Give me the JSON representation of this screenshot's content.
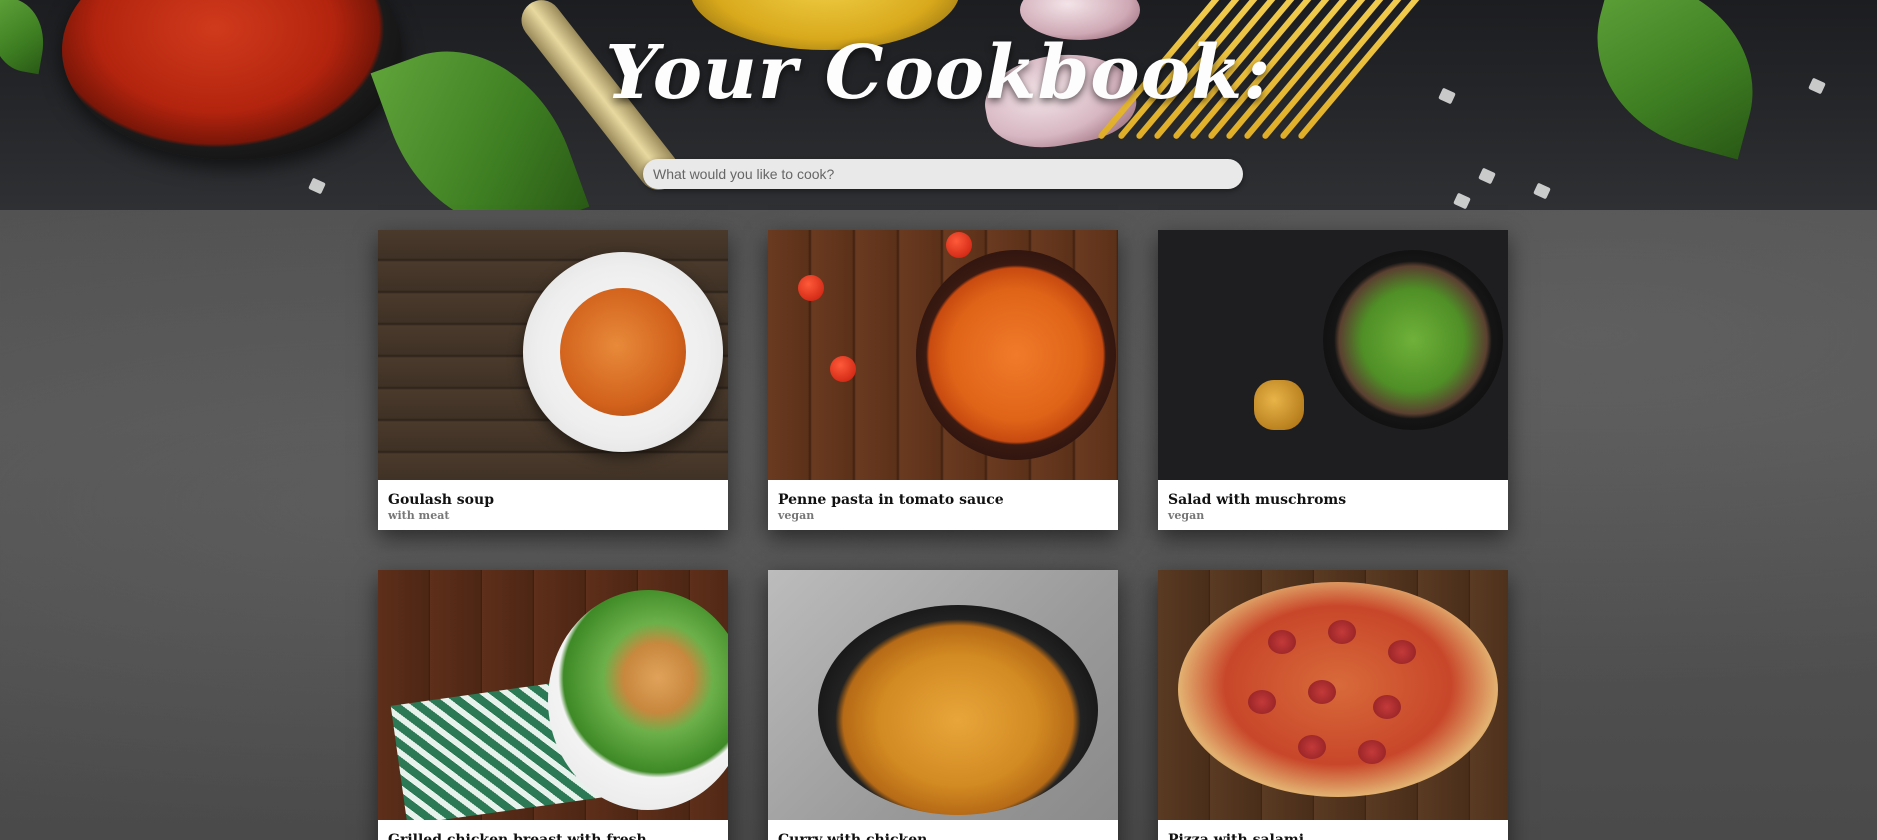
{
  "header": {
    "title": "Your Cookbook:",
    "search": {
      "placeholder": "What would you like to cook?",
      "value": ""
    }
  },
  "recipes": [
    {
      "title": "Goulash soup",
      "subtitle": "with meat",
      "image": "goulash-soup-photo"
    },
    {
      "title": "Penne pasta in tomato sauce",
      "subtitle": "vegan",
      "image": "penne-pasta-photo"
    },
    {
      "title": "Salad with muschroms",
      "subtitle": "vegan",
      "image": "salad-mushrooms-photo"
    },
    {
      "title": "Grilled chicken breast with fresh vegetable salad",
      "subtitle": "",
      "image": "grilled-chicken-photo"
    },
    {
      "title": "Curry with chicken",
      "subtitle": "",
      "image": "chicken-curry-photo"
    },
    {
      "title": "Pizza with salami",
      "subtitle": "",
      "image": "salami-pizza-photo"
    }
  ]
}
